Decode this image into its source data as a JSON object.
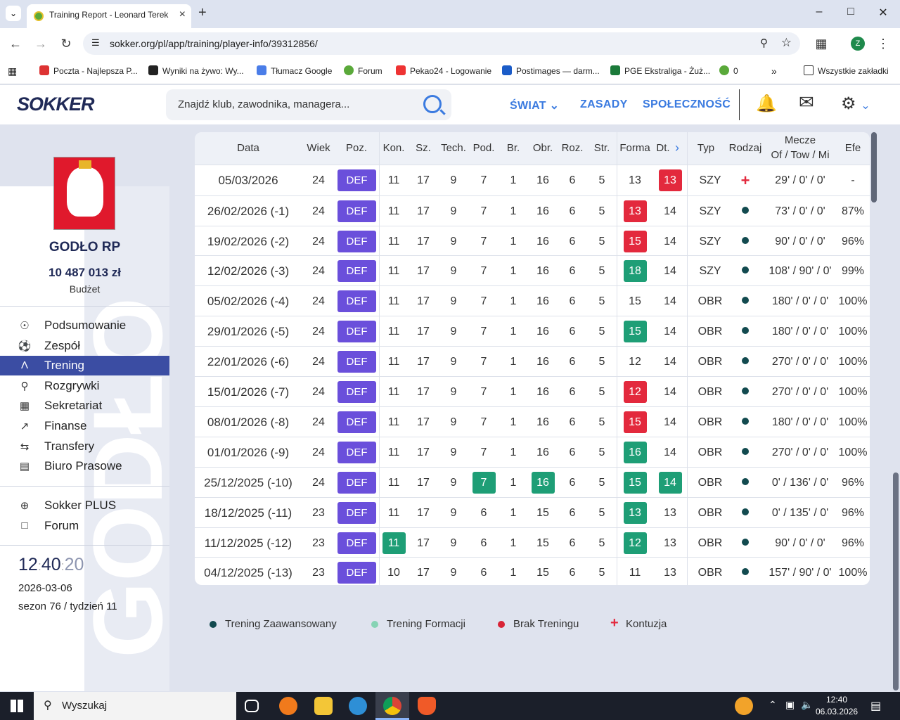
{
  "browser": {
    "tab_title": "Training Report - Leonard Terek",
    "url": "sokker.org/pl/app/training/player-info/39312856/",
    "profile_initial": "Z",
    "bookmarks": [
      "Poczta - Najlepsza P...",
      "Wyniki na żywo: Wy...",
      "Tłumacz Google",
      "Forum",
      "Pekao24 - Logowanie",
      "Postimages — darm...",
      "PGE Ekstraliga - Żuż...",
      "0"
    ],
    "all_bookmarks": "Wszystkie zakładki"
  },
  "header": {
    "logo": "SOKKER",
    "search_placeholder": "Znajdź klub, zawodnika, managera...",
    "nav": [
      "ŚWIAT",
      "ZASADY",
      "SPOŁECZNOŚĆ"
    ]
  },
  "sidebar": {
    "club_name": "GODŁO RP",
    "budget": "10 487 013 zł",
    "budget_label": "Budżet",
    "watermark": "GODŁO",
    "menu": [
      "Podsumowanie",
      "Zespół",
      "Trening",
      "Rozgrywki",
      "Sekretariat",
      "Finanse",
      "Transfery",
      "Biuro Prasowe"
    ],
    "menu2": [
      "Sokker PLUS",
      "Forum"
    ],
    "clock": {
      "h": "12",
      "m": "40",
      "s": "20"
    },
    "date": "2026-03-06",
    "season": "sezon 76 / tydzień 11"
  },
  "table": {
    "headers": [
      "Data",
      "Wiek",
      "Poz.",
      "Kon.",
      "Sz.",
      "Tech.",
      "Pod.",
      "Br.",
      "Obr.",
      "Roz.",
      "Str.",
      "Forma",
      "Dt.",
      "Typ",
      "Rodzaj",
      "Mecze",
      "Of / Tow / Mi",
      "Efe"
    ],
    "rows": [
      {
        "date": "05/03/2026",
        "age": "24",
        "pos": "DEF",
        "kon": "11",
        "sz": "17",
        "tech": "9",
        "pod": "7",
        "br": "1",
        "obr": "16",
        "roz": "6",
        "str": "5",
        "forma": "13",
        "dt": "13",
        "typ": "SZY",
        "rodzaj": "injury",
        "mecze": "29' / 0' / 0'",
        "efe": "-"
      },
      {
        "date": "26/02/2026 (-1)",
        "age": "24",
        "pos": "DEF",
        "kon": "11",
        "sz": "17",
        "tech": "9",
        "pod": "7",
        "br": "1",
        "obr": "16",
        "roz": "6",
        "str": "5",
        "forma": "13",
        "dt": "14",
        "typ": "SZY",
        "rodzaj": "advanced",
        "mecze": "73' / 0' / 0'",
        "efe": "87%"
      },
      {
        "date": "19/02/2026 (-2)",
        "age": "24",
        "pos": "DEF",
        "kon": "11",
        "sz": "17",
        "tech": "9",
        "pod": "7",
        "br": "1",
        "obr": "16",
        "roz": "6",
        "str": "5",
        "forma": "15",
        "dt": "14",
        "typ": "SZY",
        "rodzaj": "advanced",
        "mecze": "90' / 0' / 0'",
        "efe": "96%"
      },
      {
        "date": "12/02/2026 (-3)",
        "age": "24",
        "pos": "DEF",
        "kon": "11",
        "sz": "17",
        "tech": "9",
        "pod": "7",
        "br": "1",
        "obr": "16",
        "roz": "6",
        "str": "5",
        "forma": "18",
        "dt": "14",
        "typ": "SZY",
        "rodzaj": "advanced",
        "mecze": "108' / 90' / 0'",
        "efe": "99%"
      },
      {
        "date": "05/02/2026 (-4)",
        "age": "24",
        "pos": "DEF",
        "kon": "11",
        "sz": "17",
        "tech": "9",
        "pod": "7",
        "br": "1",
        "obr": "16",
        "roz": "6",
        "str": "5",
        "forma": "15",
        "dt": "14",
        "typ": "OBR",
        "rodzaj": "advanced",
        "mecze": "180' / 0' / 0'",
        "efe": "100%"
      },
      {
        "date": "29/01/2026 (-5)",
        "age": "24",
        "pos": "DEF",
        "kon": "11",
        "sz": "17",
        "tech": "9",
        "pod": "7",
        "br": "1",
        "obr": "16",
        "roz": "6",
        "str": "5",
        "forma": "15",
        "dt": "14",
        "typ": "OBR",
        "rodzaj": "advanced",
        "mecze": "180' / 0' / 0'",
        "efe": "100%"
      },
      {
        "date": "22/01/2026 (-6)",
        "age": "24",
        "pos": "DEF",
        "kon": "11",
        "sz": "17",
        "tech": "9",
        "pod": "7",
        "br": "1",
        "obr": "16",
        "roz": "6",
        "str": "5",
        "forma": "12",
        "dt": "14",
        "typ": "OBR",
        "rodzaj": "advanced",
        "mecze": "270' / 0' / 0'",
        "efe": "100%"
      },
      {
        "date": "15/01/2026 (-7)",
        "age": "24",
        "pos": "DEF",
        "kon": "11",
        "sz": "17",
        "tech": "9",
        "pod": "7",
        "br": "1",
        "obr": "16",
        "roz": "6",
        "str": "5",
        "forma": "12",
        "dt": "14",
        "typ": "OBR",
        "rodzaj": "advanced",
        "mecze": "270' / 0' / 0'",
        "efe": "100%"
      },
      {
        "date": "08/01/2026 (-8)",
        "age": "24",
        "pos": "DEF",
        "kon": "11",
        "sz": "17",
        "tech": "9",
        "pod": "7",
        "br": "1",
        "obr": "16",
        "roz": "6",
        "str": "5",
        "forma": "15",
        "dt": "14",
        "typ": "OBR",
        "rodzaj": "advanced",
        "mecze": "180' / 0' / 0'",
        "efe": "100%"
      },
      {
        "date": "01/01/2026 (-9)",
        "age": "24",
        "pos": "DEF",
        "kon": "11",
        "sz": "17",
        "tech": "9",
        "pod": "7",
        "br": "1",
        "obr": "16",
        "roz": "6",
        "str": "5",
        "forma": "16",
        "dt": "14",
        "typ": "OBR",
        "rodzaj": "advanced",
        "mecze": "270' / 0' / 0'",
        "efe": "100%"
      },
      {
        "date": "25/12/2025 (-10)",
        "age": "24",
        "pos": "DEF",
        "kon": "11",
        "sz": "17",
        "tech": "9",
        "pod": "7",
        "br": "1",
        "obr": "16",
        "roz": "6",
        "str": "5",
        "forma": "15",
        "dt": "14",
        "typ": "OBR",
        "rodzaj": "advanced",
        "mecze": "0' / 136' / 0'",
        "efe": "96%"
      },
      {
        "date": "18/12/2025 (-11)",
        "age": "23",
        "pos": "DEF",
        "kon": "11",
        "sz": "17",
        "tech": "9",
        "pod": "6",
        "br": "1",
        "obr": "15",
        "roz": "6",
        "str": "5",
        "forma": "13",
        "dt": "13",
        "typ": "OBR",
        "rodzaj": "advanced",
        "mecze": "0' / 135' / 0'",
        "efe": "96%"
      },
      {
        "date": "11/12/2025 (-12)",
        "age": "23",
        "pos": "DEF",
        "kon": "11",
        "sz": "17",
        "tech": "9",
        "pod": "6",
        "br": "1",
        "obr": "15",
        "roz": "6",
        "str": "5",
        "forma": "12",
        "dt": "13",
        "typ": "OBR",
        "rodzaj": "advanced",
        "mecze": "90' / 0' / 0'",
        "efe": "96%"
      },
      {
        "date": "04/12/2025 (-13)",
        "age": "23",
        "pos": "DEF",
        "kon": "10",
        "sz": "17",
        "tech": "9",
        "pod": "6",
        "br": "1",
        "obr": "15",
        "roz": "6",
        "str": "5",
        "forma": "11",
        "dt": "13",
        "typ": "OBR",
        "rodzaj": "advanced",
        "mecze": "157' / 90' / 0'",
        "efe": "100%"
      }
    ],
    "highlights": {
      "0": {
        "dt": "red"
      },
      "1": {
        "forma": "red"
      },
      "2": {
        "forma": "red"
      },
      "3": {
        "forma": "green"
      },
      "5": {
        "forma": "green"
      },
      "7": {
        "forma": "red"
      },
      "8": {
        "forma": "red"
      },
      "9": {
        "forma": "green"
      },
      "10": {
        "pod": "green",
        "obr": "green",
        "forma": "green",
        "dt": "green"
      },
      "11": {
        "forma": "green"
      },
      "12": {
        "kon": "green",
        "forma": "green"
      }
    }
  },
  "legend": [
    {
      "label": "Trening Zaawansowany",
      "color": "#124a4f"
    },
    {
      "label": "Trening Formacji",
      "color": "#86d3b4"
    },
    {
      "label": "Brak Treningu",
      "color": "#d82436"
    },
    {
      "label": "Kontuzja",
      "color": "#e3293d"
    }
  ],
  "taskbar": {
    "search": "Wyszukaj",
    "time": "12:40",
    "date": "06.03.2026"
  }
}
